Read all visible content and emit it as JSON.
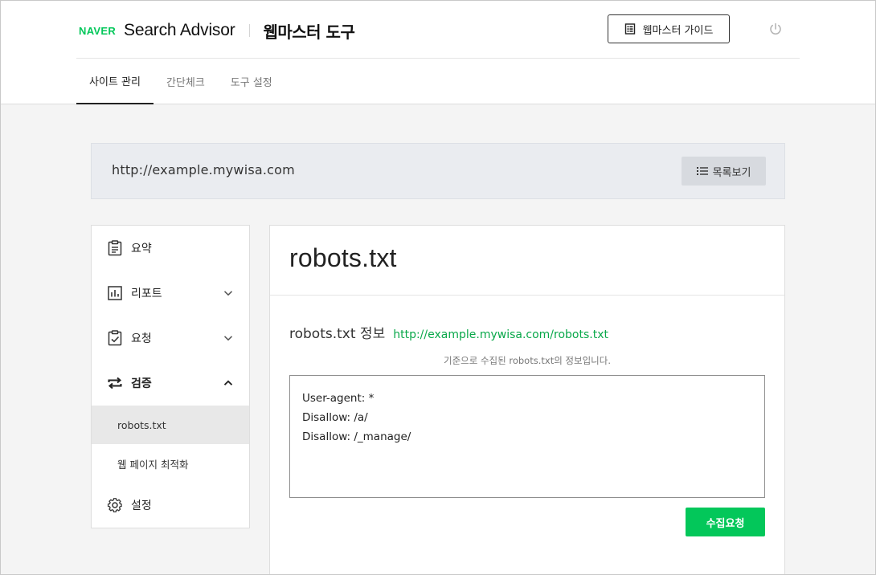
{
  "header": {
    "logo_text": "NAVER",
    "brand_title": "Search Advisor",
    "subtitle": "웹마스터 도구",
    "guide_button": "웹마스터 가이드",
    "power_icon": "power-icon"
  },
  "tabs": [
    {
      "label": "사이트 관리",
      "active": true
    },
    {
      "label": "간단체크",
      "active": false
    },
    {
      "label": "도구 설정",
      "active": false
    }
  ],
  "site": {
    "url": "http://example.mywisa.com",
    "list_button": "목록보기"
  },
  "sidebar": {
    "items": [
      {
        "label": "요약",
        "icon": "clipboard-icon"
      },
      {
        "label": "리포트",
        "icon": "chart-icon",
        "chevron": "down"
      },
      {
        "label": "요청",
        "icon": "clipboard-check-icon",
        "chevron": "down"
      },
      {
        "label": "검증",
        "icon": "repeat-icon",
        "chevron": "up"
      },
      {
        "label": "설정",
        "icon": "gear-icon"
      }
    ],
    "sub_items": [
      {
        "label": "robots.txt",
        "active": true
      },
      {
        "label": "웹 페이지 최적화",
        "active": false
      }
    ]
  },
  "main": {
    "title": "robots.txt",
    "info_label": "robots.txt 정보",
    "info_link": "http://example.mywisa.com/robots.txt",
    "description": "기준으로 수집된 robots.txt의 정보입니다.",
    "robots_lines": [
      "User-agent: *",
      "Disallow: /a/",
      "Disallow: /_manage/"
    ],
    "collect_button": "수집요청"
  },
  "colors": {
    "naver_green": "#03c75a",
    "link_green": "#09a84a",
    "accent_dark": "#222222"
  }
}
